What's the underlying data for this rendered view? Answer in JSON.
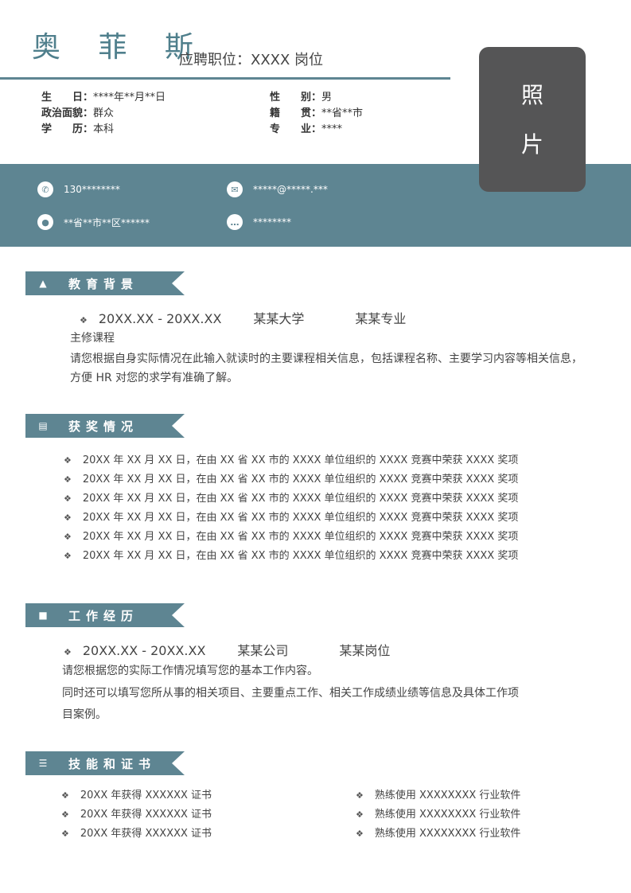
{
  "header": {
    "name": "奥 菲 斯",
    "position": "应聘职位：XXXX 岗位"
  },
  "photo": {
    "line1": "照",
    "line2": "片"
  },
  "info": {
    "birthday_label": "生　　日：",
    "birthday_value": "****年**月**日",
    "political_label": "政治面貌：",
    "political_value": "群众",
    "education_label": "学　　历：",
    "education_value": "本科",
    "gender_label": "性　　别：",
    "gender_value": "男",
    "native_label": "籍　　贯：",
    "native_value": "**省**市",
    "major_label": "专　　业：",
    "major_value": "****"
  },
  "contact": {
    "phone": "130********",
    "email": "*****@*****.***",
    "address": "**省**市**区******",
    "chat": "********",
    "icons": [
      "phone-icon",
      "mail-icon",
      "location-icon",
      "chat-icon"
    ]
  },
  "sections": {
    "education": "教育背景",
    "awards": "获奖情况",
    "work": "工作经历",
    "skills": "技能和证书"
  },
  "education": {
    "period": "20XX.XX - 20XX.XX",
    "school": "某某大学",
    "major": "某某专业",
    "courses_label": "主修课程",
    "desc1": "请您根据自身实际情况在此输入就读时的主要课程相关信息，包括课程名称、主要学习内容等相关信息，",
    "desc2": "方便 HR 对您的求学有准确了解。"
  },
  "awards": [
    "20XX 年 XX 月 XX 日，在由 XX 省 XX 市的 XXXX 单位组织的 XXXX 竞赛中荣获 XXXX 奖项",
    "20XX 年 XX 月 XX 日，在由 XX 省 XX 市的 XXXX 单位组织的 XXXX 竞赛中荣获 XXXX 奖项",
    "20XX 年 XX 月 XX 日，在由 XX 省 XX 市的 XXXX 单位组织的 XXXX 竞赛中荣获 XXXX 奖项",
    "20XX 年 XX 月 XX 日，在由 XX 省 XX 市的 XXXX 单位组织的 XXXX 竞赛中荣获 XXXX 奖项",
    "20XX 年 XX 月 XX 日，在由 XX 省 XX 市的 XXXX 单位组织的 XXXX 竞赛中荣获 XXXX 奖项",
    "20XX 年 XX 月 XX 日，在由 XX 省 XX 市的 XXXX 单位组织的 XXXX 竞赛中荣获 XXXX 奖项"
  ],
  "work": {
    "period": "20XX.XX - 20XX.XX",
    "company": "某某公司",
    "job": "某某岗位",
    "line1": "请您根据您的实际工作情况填写您的基本工作内容。",
    "line2": "同时还可以填写您所从事的相关项目、主要重点工作、相关工作成绩业绩等信息及具体工作项",
    "line3": "目案例。"
  },
  "skills": {
    "certs": [
      "20XX 年获得 XXXXXX 证书",
      "20XX 年获得 XXXXXX 证书",
      "20XX 年获得 XXXXXX 证书"
    ],
    "software": [
      "熟练使用 XXXXXXXX 行业软件",
      "熟练使用 XXXXXXXX 行业软件",
      "熟练使用 XXXXXXXX 行业软件"
    ]
  },
  "colors": {
    "accent": "#5e8592",
    "name": "#4f7f8c",
    "photo_bg": "#555556"
  }
}
